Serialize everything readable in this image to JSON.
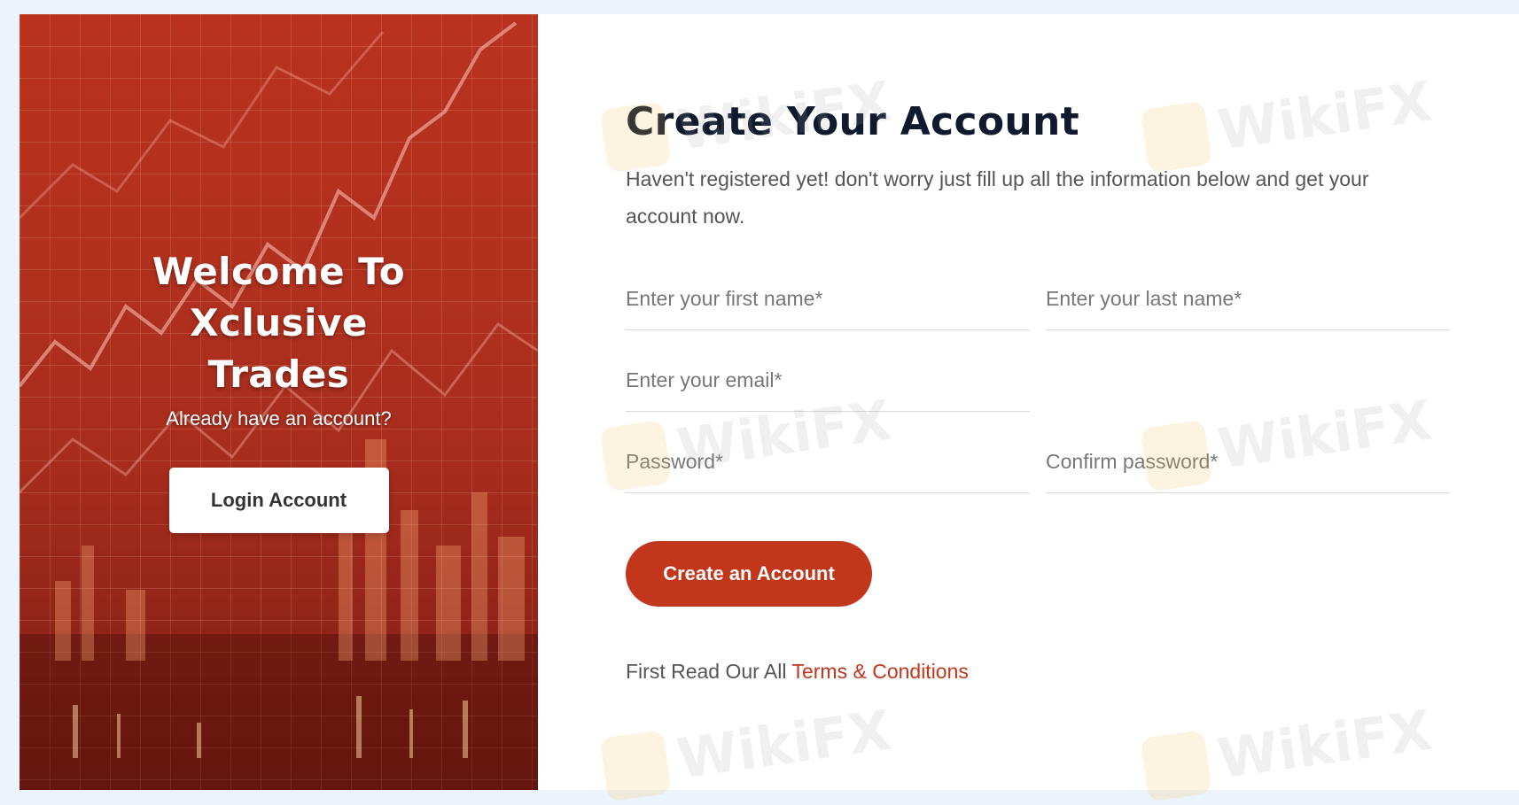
{
  "hero": {
    "title": "Welcome To Xclusive Trades",
    "subtitle": "Already have an account?",
    "login_label": "Login Account"
  },
  "form": {
    "title": "Create Your Account",
    "intro": "Haven't registered yet! don't worry just fill up all the information below and get your account now.",
    "first_name_placeholder": "Enter your first name*",
    "last_name_placeholder": "Enter your last name*",
    "email_placeholder": "Enter your email*",
    "password_placeholder": "Password*",
    "confirm_placeholder": "Confirm password*",
    "submit_label": "Create an Account",
    "terms_prefix": "First Read Our All",
    "terms_link": "Terms & Conditions"
  },
  "watermark": "WikiFX",
  "colors": {
    "accent": "#c2361c",
    "hero_bg": "#b0301e",
    "heading": "#0f1a2e"
  }
}
